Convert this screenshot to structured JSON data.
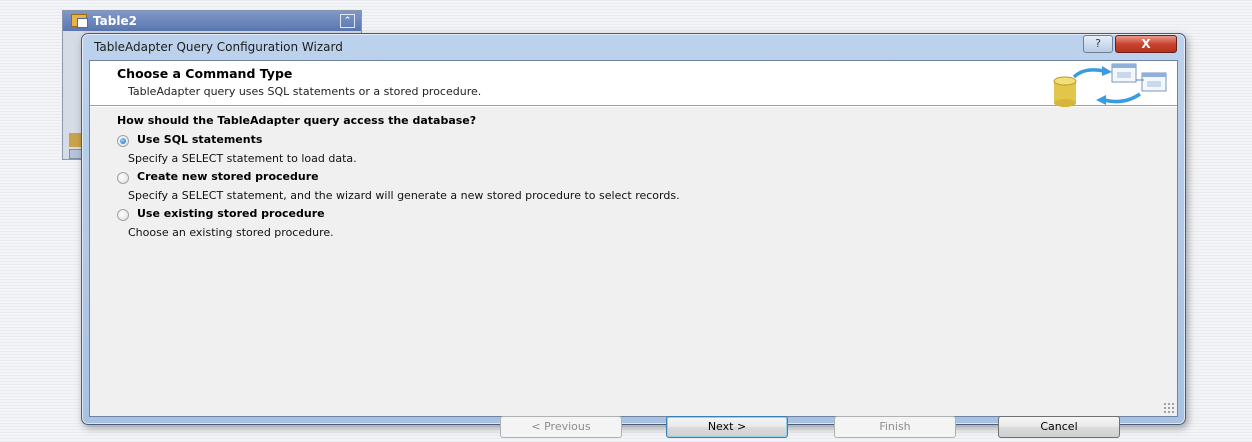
{
  "background": {
    "table_title": "Table2",
    "collapse_glyph": "⌃"
  },
  "dialog": {
    "title": "TableAdapter Query Configuration Wizard",
    "help_glyph": "?",
    "close_glyph": "X",
    "header": {
      "title": "Choose a Command Type",
      "description": "TableAdapter query uses SQL statements or a stored procedure.",
      "art_icon": "database-tables-icon"
    },
    "question": "How should the TableAdapter query access the database?",
    "options": [
      {
        "label": "Use SQL statements",
        "description": "Specify a SELECT statement to load data.",
        "checked": true
      },
      {
        "label": "Create new stored procedure",
        "description": "Specify a SELECT statement, and the wizard will generate a new stored procedure to select records.",
        "checked": false
      },
      {
        "label": "Use existing stored procedure",
        "description": "Choose an existing stored procedure.",
        "checked": false
      }
    ],
    "buttons": {
      "previous": "< Previous",
      "next": "Next >",
      "finish": "Finish",
      "cancel": "Cancel"
    }
  },
  "colors": {
    "titlebar": "#bcd2ec",
    "close": "#c94430",
    "radio_selected": "#1b6fc4"
  }
}
